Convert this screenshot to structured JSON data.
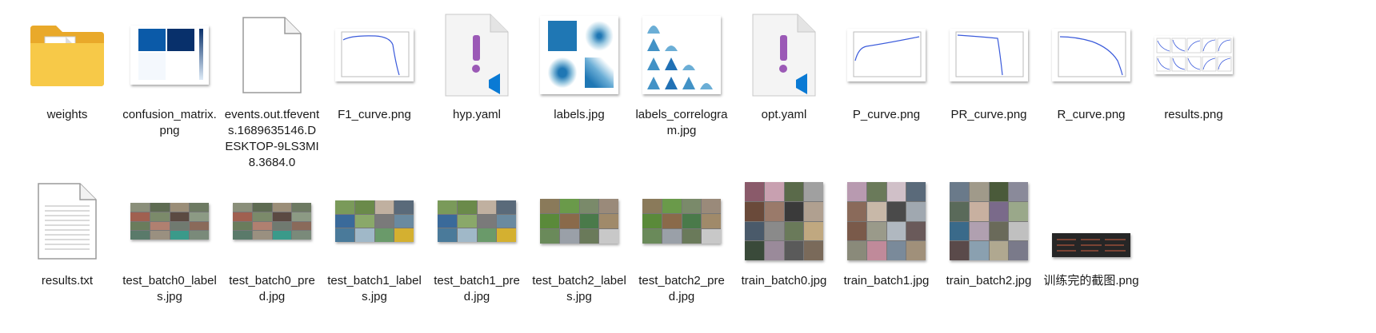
{
  "files": [
    {
      "name": "weights",
      "icon": "folder-icon"
    },
    {
      "name": "confusion_matrix.png",
      "icon": "image-thumbnail"
    },
    {
      "name": "events.out.tfevents.1689635146.DESKTOP-9LS3MI8.3684.0",
      "icon": "blank-file-icon"
    },
    {
      "name": "F1_curve.png",
      "icon": "image-thumbnail"
    },
    {
      "name": "hyp.yaml",
      "icon": "vscode-yaml-icon"
    },
    {
      "name": "labels.jpg",
      "icon": "image-thumbnail"
    },
    {
      "name": "labels_correlogram.jpg",
      "icon": "image-thumbnail"
    },
    {
      "name": "opt.yaml",
      "icon": "vscode-yaml-icon"
    },
    {
      "name": "P_curve.png",
      "icon": "image-thumbnail"
    },
    {
      "name": "PR_curve.png",
      "icon": "image-thumbnail"
    },
    {
      "name": "R_curve.png",
      "icon": "image-thumbnail"
    },
    {
      "name": "results.png",
      "icon": "image-thumbnail"
    },
    {
      "name": "results.txt",
      "icon": "text-file-icon"
    },
    {
      "name": "test_batch0_labels.jpg",
      "icon": "image-thumbnail"
    },
    {
      "name": "test_batch0_pred.jpg",
      "icon": "image-thumbnail"
    },
    {
      "name": "test_batch1_labels.jpg",
      "icon": "image-thumbnail"
    },
    {
      "name": "test_batch1_pred.jpg",
      "icon": "image-thumbnail"
    },
    {
      "name": "test_batch2_labels.jpg",
      "icon": "image-thumbnail"
    },
    {
      "name": "test_batch2_pred.jpg",
      "icon": "image-thumbnail"
    },
    {
      "name": "train_batch0.jpg",
      "icon": "image-thumbnail"
    },
    {
      "name": "train_batch1.jpg",
      "icon": "image-thumbnail"
    },
    {
      "name": "train_batch2.jpg",
      "icon": "image-thumbnail"
    },
    {
      "name": "训练完的截图.png",
      "icon": "image-thumbnail"
    }
  ],
  "colors": {
    "folder": "#f5c33b",
    "folder_front": "#ffd75e",
    "vscode_exclamation": "#9b59b6",
    "vscode_badge": "#0a7ad4",
    "plot_line": "#3b5bdb",
    "confusion_dark": "#08306b",
    "confusion_mid": "#0b5aa8"
  }
}
